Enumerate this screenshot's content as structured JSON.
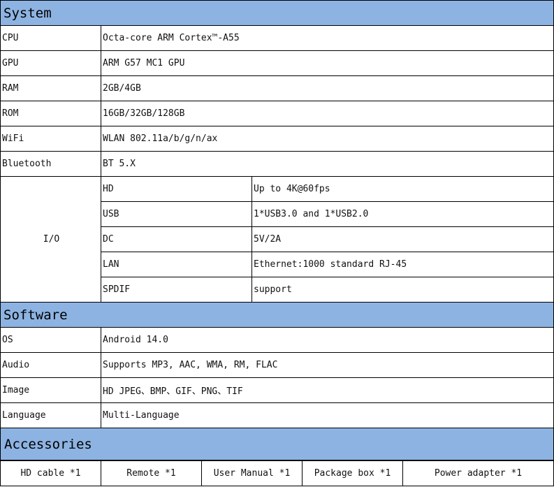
{
  "system": {
    "title": "System",
    "rows": [
      {
        "label": "CPU",
        "value": "Octa-core ARM Cortex™-A55"
      },
      {
        "label": "GPU",
        "value": "ARM G57 MC1 GPU"
      },
      {
        "label": "RAM",
        "value": "2GB/4GB"
      },
      {
        "label": "ROM",
        "value": "16GB/32GB/128GB"
      },
      {
        "label": "WiFi",
        "value": "WLAN 802.11a/b/g/n/ax"
      },
      {
        "label": "Bluetooth",
        "value": "BT 5.X"
      }
    ],
    "io": {
      "label": "I/O",
      "rows": [
        {
          "port": "HD",
          "value": "Up to 4K@60fps"
        },
        {
          "port": "USB",
          "value": "1*USB3.0 and 1*USB2.0"
        },
        {
          "port": "DC",
          "value": "5V/2A"
        },
        {
          "port": "LAN",
          "value": "Ethernet:1000 standard RJ-45"
        },
        {
          "port": "SPDIF",
          "value": "support"
        }
      ]
    }
  },
  "software": {
    "title": "Software",
    "rows": [
      {
        "label": "OS",
        "value": "Android 14.0"
      },
      {
        "label": "Audio",
        "value": "Supports MP3, AAC, WMA, RM, FLAC"
      },
      {
        "label": "Image",
        "value": "HD JPEG、BMP、GIF、PNG、TIF"
      },
      {
        "label": "Language",
        "value": "Multi-Language"
      }
    ]
  },
  "accessories": {
    "title": "Accessories",
    "items": [
      "HD cable *1",
      "Remote *1",
      "User Manual *1",
      "Package box *1",
      "Power adapter *1"
    ]
  },
  "colors": {
    "section_header_bg": "#8db3e2",
    "border": "#000000"
  }
}
